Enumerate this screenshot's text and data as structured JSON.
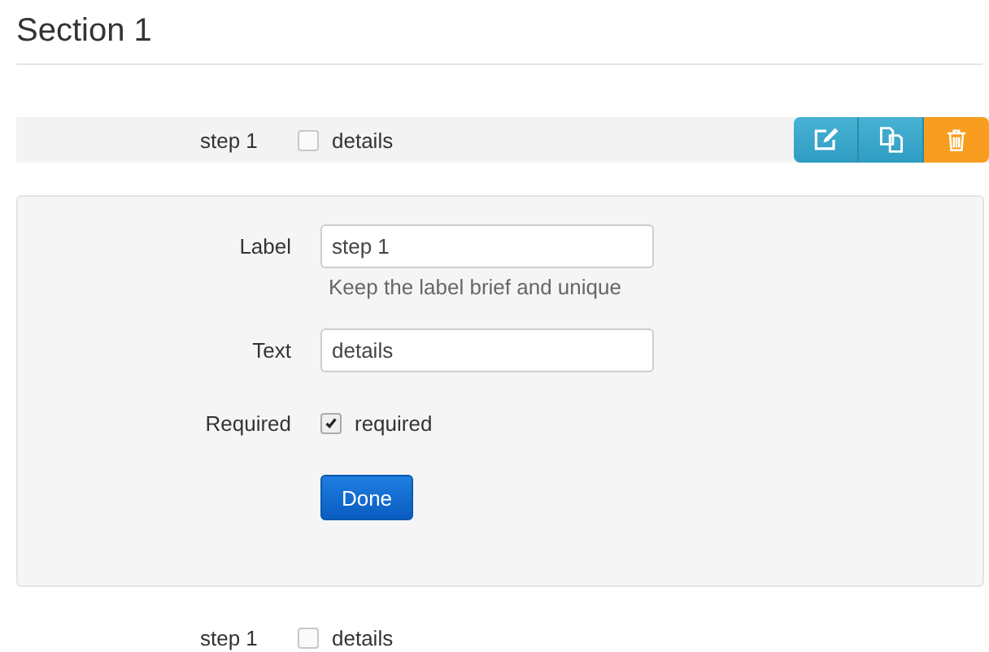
{
  "section": {
    "title": "Section 1"
  },
  "rows": [
    {
      "highlighted": true,
      "label": "step 1",
      "text": "details",
      "checked": false,
      "actions": [
        {
          "kind": "edit"
        },
        {
          "kind": "copy"
        },
        {
          "kind": "delete"
        }
      ]
    },
    {
      "highlighted": false,
      "label": "step 1",
      "text": "details",
      "checked": false,
      "actions": []
    }
  ],
  "editor": {
    "fields": [
      {
        "kind": "text",
        "label": "Label",
        "value": "step 1",
        "help": "Keep the label brief and unique"
      },
      {
        "kind": "text",
        "label": "Text",
        "value": "details"
      },
      {
        "kind": "checkbox",
        "label": "Required",
        "option": "required",
        "checked": true
      }
    ],
    "button": "Done"
  }
}
